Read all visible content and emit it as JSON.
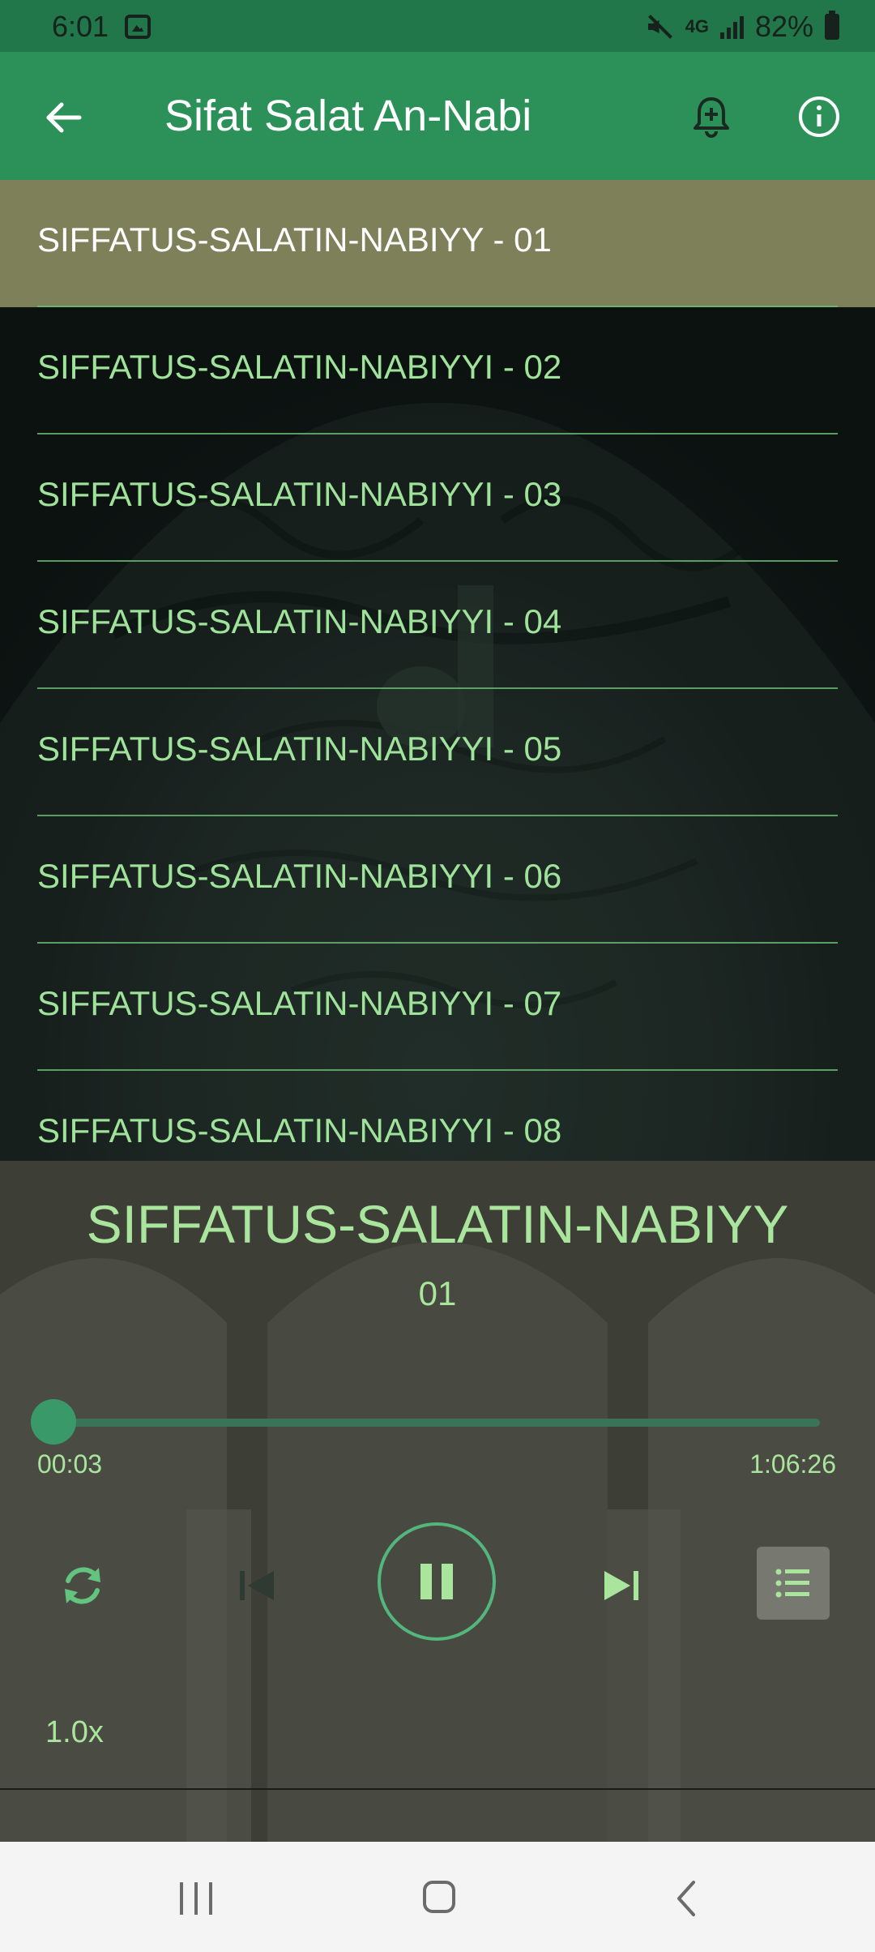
{
  "status_bar": {
    "time": "6:01",
    "network": "4G",
    "battery": "82%"
  },
  "app_bar": {
    "title": "Sifat Salat An-Nabi",
    "back_icon": "arrow-left-icon",
    "notify_icon": "bell-plus-icon",
    "info_icon": "info-icon"
  },
  "tracks": [
    {
      "label": "SIFFATUS-SALATIN-NABIYY - 01",
      "active": true
    },
    {
      "label": "SIFFATUS-SALATIN-NABIYYI - 02",
      "active": false
    },
    {
      "label": "SIFFATUS-SALATIN-NABIYYI - 03",
      "active": false
    },
    {
      "label": "SIFFATUS-SALATIN-NABIYYI - 04",
      "active": false
    },
    {
      "label": "SIFFATUS-SALATIN-NABIYYI - 05",
      "active": false
    },
    {
      "label": "SIFFATUS-SALATIN-NABIYYI - 06",
      "active": false
    },
    {
      "label": "SIFFATUS-SALATIN-NABIYYI - 07",
      "active": false
    },
    {
      "label": "SIFFATUS-SALATIN-NABIYYI - 08",
      "active": false
    }
  ],
  "player": {
    "title": "SIFFATUS-SALATIN-NABIYY",
    "subtitle": "01",
    "current_time": "00:03",
    "total_time": "1:06:26",
    "progress_fraction": 0.0008,
    "speed": "1.0x",
    "state": "playing"
  },
  "colors": {
    "app_bar": "#2c9159",
    "status_bar": "#22774a",
    "accent_text": "#9fe39a",
    "active_row": "#7d8059",
    "player_bg": "#3d3e36"
  }
}
